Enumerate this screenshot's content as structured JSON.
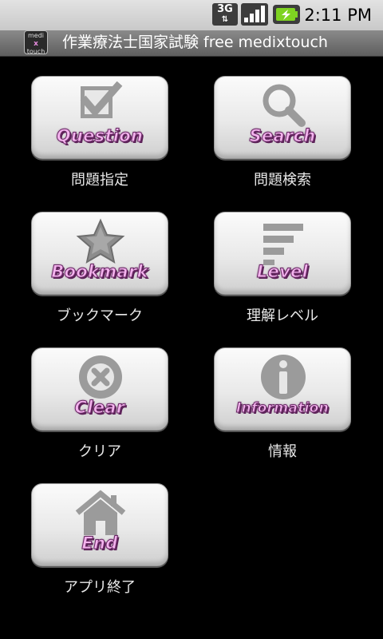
{
  "status_bar": {
    "network": "3G",
    "time": "2:11 PM",
    "icons": [
      "3g-icon",
      "signal-icon",
      "battery-charging-icon"
    ]
  },
  "title_bar": {
    "app_icon_text_top": "medi",
    "app_icon_text_mid": "x",
    "app_icon_text_bottom": "touch",
    "title": "作業療法士国家試験 free medixtouch"
  },
  "menu": [
    {
      "label": "Question",
      "caption": "問題指定",
      "icon": "checkbox-icon"
    },
    {
      "label": "Search",
      "caption": "問題検索",
      "icon": "magnifier-icon"
    },
    {
      "label": "Bookmark",
      "caption": "ブックマーク",
      "icon": "star-icon"
    },
    {
      "label": "Level",
      "caption": "理解レベル",
      "icon": "level-bars-icon"
    },
    {
      "label": "Clear",
      "caption": "クリア",
      "icon": "x-circle-icon"
    },
    {
      "label": "Information",
      "caption": "情報",
      "icon": "info-icon"
    },
    {
      "label": "End",
      "caption": "アプリ終了",
      "icon": "home-icon"
    }
  ],
  "colors": {
    "background": "#000000",
    "button_label": "#f4b3ee",
    "button_label_outline": "#6a2a66",
    "icon_gray": "#9b9b9b"
  }
}
